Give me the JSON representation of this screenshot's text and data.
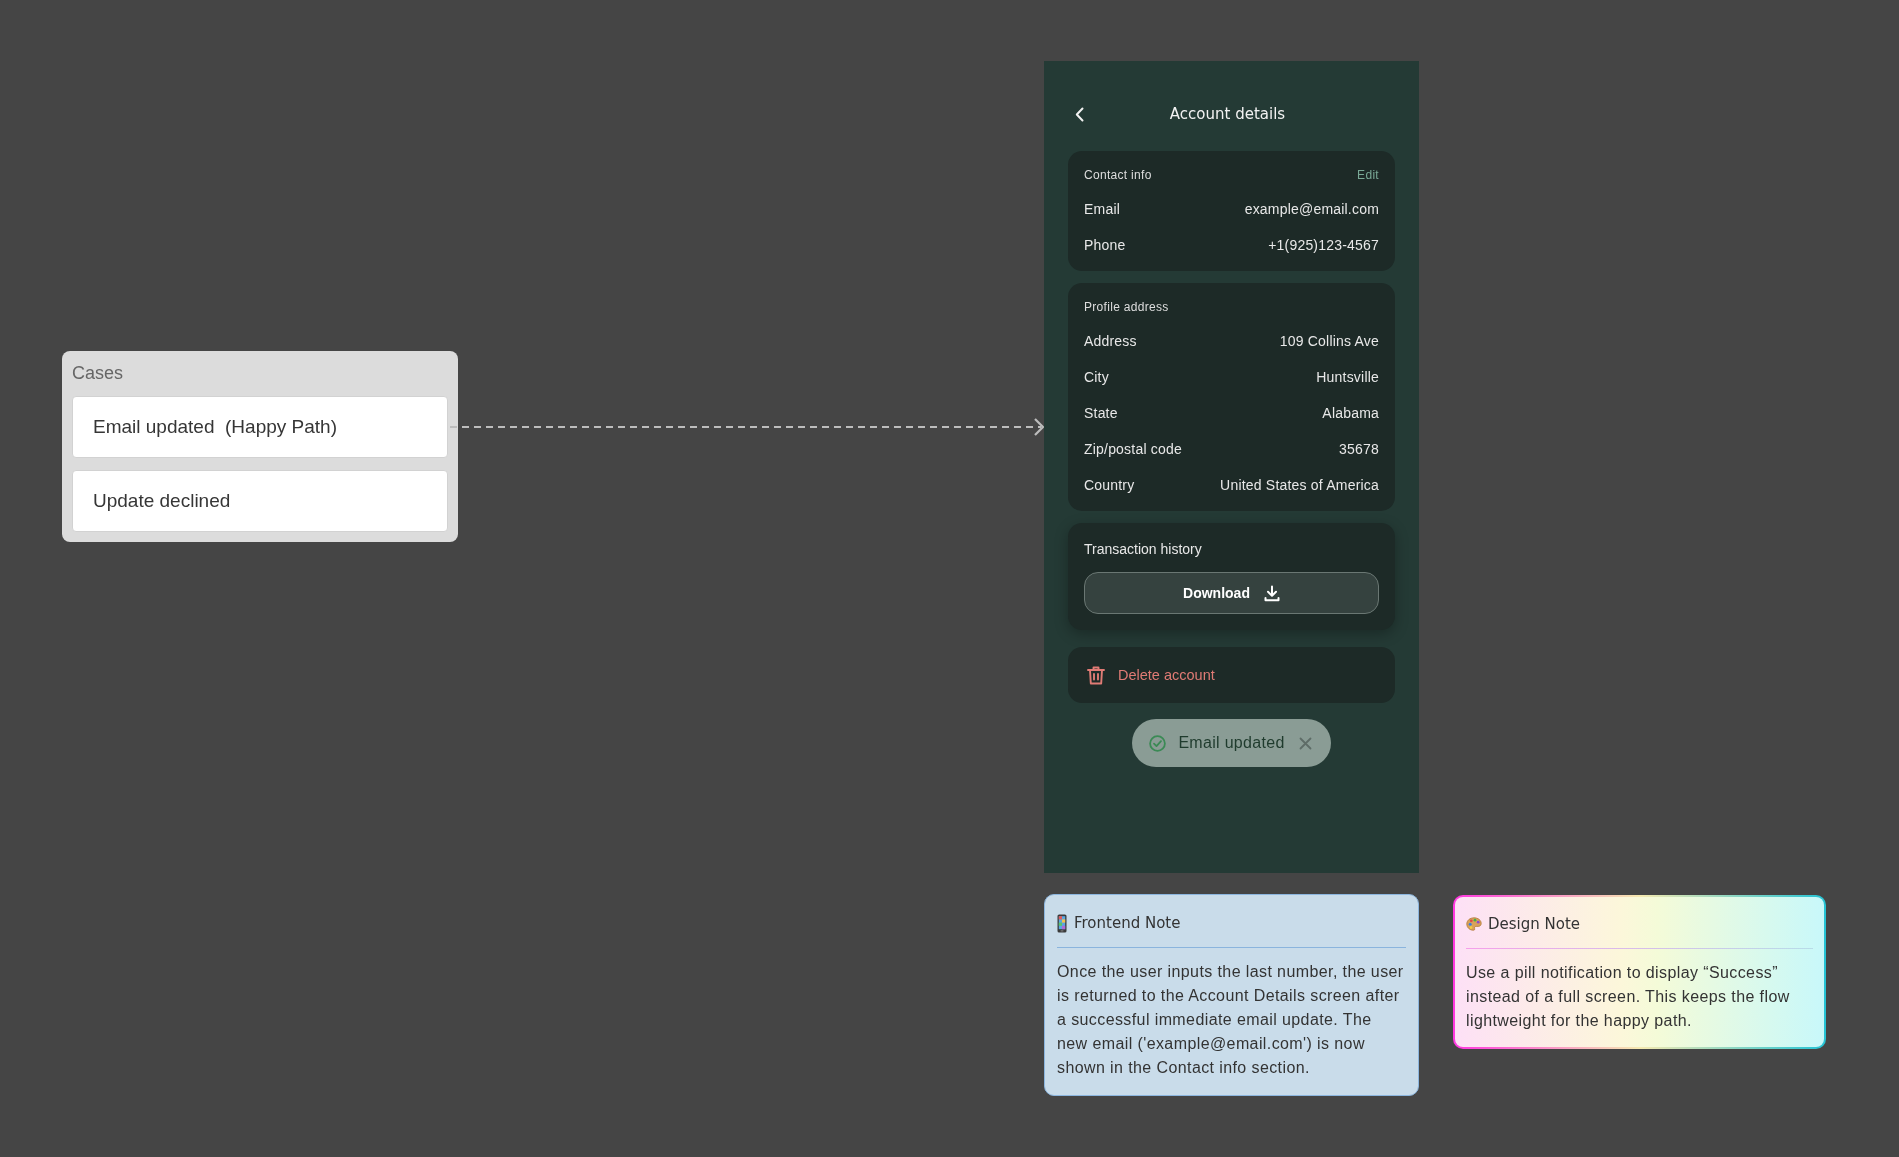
{
  "cases_panel": {
    "title": "Cases",
    "cases": [
      "Email updated  (Happy Path)",
      "Update declined"
    ]
  },
  "phone_screen": {
    "header": {
      "title": "Account details"
    },
    "sections": [
      {
        "kind": "fields",
        "title": "Contact info",
        "action": "Edit",
        "fields": [
          {
            "label": "Email",
            "value": "example@email.com"
          },
          {
            "label": "Phone",
            "value": "+1(925)123-4567"
          }
        ]
      },
      {
        "kind": "fields",
        "title": "Profile address",
        "fields": [
          {
            "label": "Address",
            "value": "109 Collins Ave"
          },
          {
            "label": "City",
            "value": "Huntsville"
          },
          {
            "label": "State",
            "value": "Alabama"
          },
          {
            "label": "Zip/postal code",
            "value": "35678"
          },
          {
            "label": "Country",
            "value": "United States of America"
          }
        ]
      },
      {
        "kind": "download",
        "title": "Transaction history",
        "button": "Download"
      },
      {
        "kind": "danger",
        "label": "Delete account"
      }
    ],
    "toast": {
      "text": "Email updated"
    }
  },
  "notes": [
    {
      "kind": "frontend",
      "title": "Frontend Note",
      "body": "Once the user inputs the last number, the user is returned to the Account Details screen after a successful immediate email update. The new email ('example@email.com') is now shown in the Contact info section."
    },
    {
      "kind": "design",
      "title": "Design Note",
      "body": "Use a pill notification to display “Success” instead of a full screen. This keeps the flow lightweight for the happy path."
    }
  ]
}
